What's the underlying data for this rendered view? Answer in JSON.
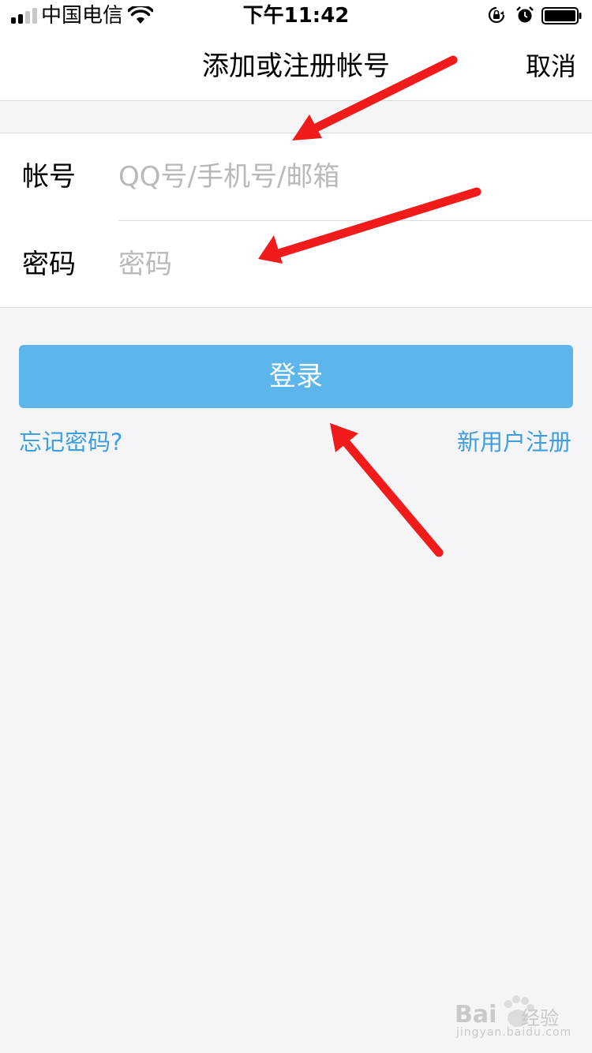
{
  "status_bar": {
    "carrier": "中国电信",
    "time": "下午11:42",
    "icons": [
      "signal-icon",
      "wifi-icon",
      "rotation-lock-icon",
      "alarm-icon",
      "battery-icon"
    ]
  },
  "nav": {
    "title": "添加或注册帐号",
    "cancel_label": "取消"
  },
  "form": {
    "account": {
      "label": "帐号",
      "placeholder": "QQ号/手机号/邮箱",
      "value": ""
    },
    "password": {
      "label": "密码",
      "placeholder": "密码",
      "value": ""
    }
  },
  "login_label": "登录",
  "links": {
    "forgot_password": "忘记密码?",
    "new_user_register": "新用户注册"
  },
  "watermark": {
    "brand": "Bai",
    "brand_cn": "经验",
    "url": "jingyan.baidu.com"
  },
  "colors": {
    "accent": "#5cb6ec",
    "link": "#3d9fe0",
    "annotation_arrow": "#f21b1b",
    "background": "#f5f5f8"
  }
}
